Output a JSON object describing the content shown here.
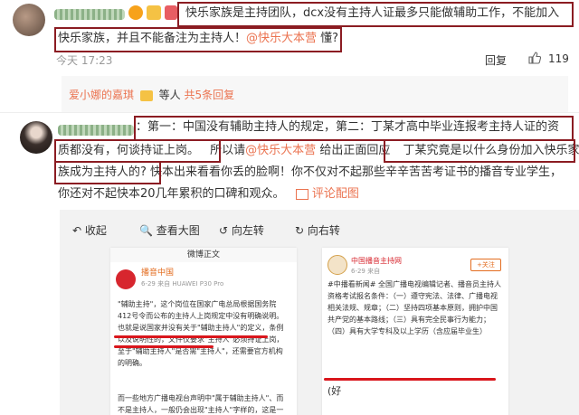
{
  "comment1": {
    "text_part1": "快乐家族是主持团队，dcx没有主持人证最多只能做辅助工作，不能加入",
    "text_part2": "快乐家族，并且不能备注为主持人！",
    "mention": "@快乐大本营",
    "text_part3": " 懂?",
    "timestamp": "今天 17:23",
    "reply_label": "回复",
    "like_count": "119"
  },
  "sub_reply": {
    "user": "爱小娜的嘉琪",
    "text": "等人",
    "replies_link": "共5条回复"
  },
  "comment2": {
    "line1": "：第一：中国没有辅助主持人的规定，第二：丁某才高中毕业连报考主持人证的资",
    "line2a": "质都没有，何谈持证上岗。",
    "line2b": "所以请",
    "line2_mention": "@快乐大本营",
    "line2c": " 给出正面回应",
    "line2d": "丁某究竟是以什么身份加入快乐家",
    "line3a": "族成为主持人的?",
    "line3b": " 快本出来看看你丢的脸啊！你不仅对不起那些辛辛苦苦考证书的播音专业学生，",
    "line4": "你还对不起快本20几年累积的口碑和观众。",
    "comment_image_link": "评论配图"
  },
  "embed": {
    "toolbar": [
      "收起",
      "查看大图",
      "向左转",
      "向右转"
    ],
    "left_card": {
      "header": "微博正文",
      "account": "播音中国",
      "meta": "6-29 来自 HUAWEI P30 Pro",
      "body": "\"辅助主持\"，这个岗位在国家广电总局根据国务院412号令而公布的主持人上岗规定中没有明确说明。也就是说国家并没有关于\"辅助主持人\"的定义，条例以及说明性的，文件仅要求\"主持人\"必须持证上岗，至于\"辅助主持人\"是否需\"主持人\"，还需要官方机构的明确。",
      "footer": "而一些地方广播电视台声明中\"属于辅助主持人\"、而不是主持人，一般仍会出现\"主持人\"字样的，这是一直以来的惯例与平台"
    },
    "right_card": {
      "account": "中国播音主持网",
      "meta": "6-29 来自",
      "follow": "+关注",
      "body": "#中播看新闻# 全国广播电视编辑记者、播音员主持人资格考试报名条件：（一）遵守宪法、法律、广播电视相关法规、规章；（二）坚持四项基本原则，拥护中国共产党的基本路线；（三）具有完全民事行为能力；（四）具有大学专科及以上学历（含应届毕业生）",
      "reply_hint": "(好"
    }
  },
  "colors": {
    "box": "#8b1c22",
    "mention": "#eb7350",
    "underline": "#d9161c"
  }
}
